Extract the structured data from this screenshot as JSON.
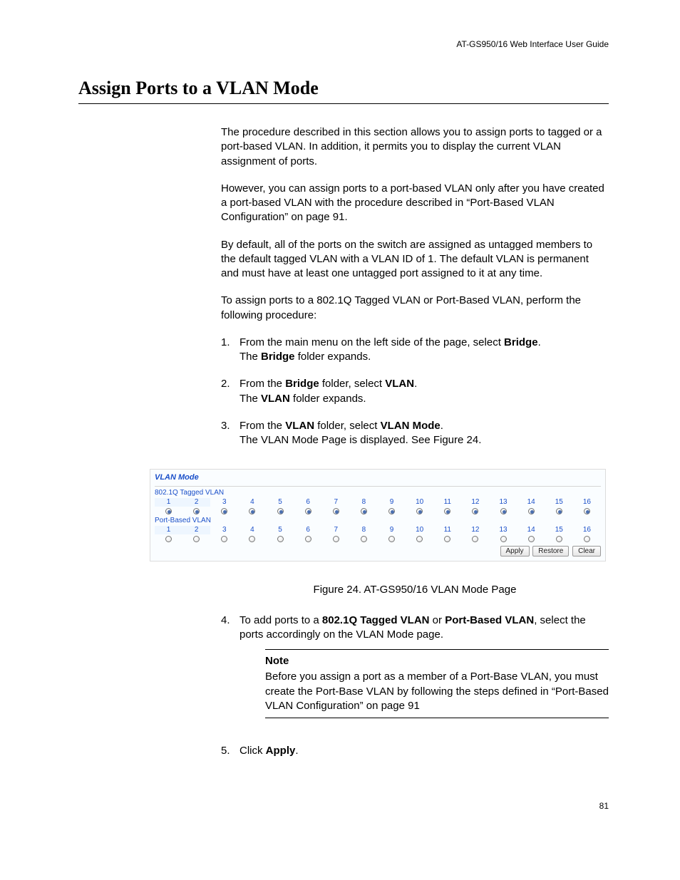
{
  "header": {
    "docTitle": "AT-GS950/16 Web Interface User Guide"
  },
  "title": "Assign Ports to a VLAN Mode",
  "para1": "The procedure described in this section allows you to assign ports to tagged or a port-based VLAN. In addition, it permits you to display the current VLAN assignment of ports.",
  "para2": "However, you can assign ports to a port-based VLAN only after you have created a port-based VLAN with the procedure described in “Port-Based VLAN Configuration” on page 91.",
  "para3": "By default, all of the ports on the switch are assigned as untagged members to the default tagged VLAN with a VLAN ID of 1. The default VLAN is permanent and must have at least one untagged port assigned to it at any time.",
  "para4": "To assign ports to a 802.1Q Tagged VLAN or Port-Based VLAN, perform the following procedure:",
  "steps": {
    "s1num": "1.",
    "s1a": "From the main menu on the left side of the page, select ",
    "s1b": "Bridge",
    "s1c": ".",
    "s1d": "The ",
    "s1e": "Bridge",
    "s1f": " folder expands.",
    "s2num": "2.",
    "s2a": "From the ",
    "s2b": "Bridge",
    "s2c": " folder, select ",
    "s2d": "VLAN",
    "s2e": ".",
    "s2f": "The ",
    "s2g": "VLAN",
    "s2h": " folder expands.",
    "s3num": "3.",
    "s3a": "From the ",
    "s3b": "VLAN",
    "s3c": " folder, select ",
    "s3d": "VLAN Mode",
    "s3e": ".",
    "s3f": "The VLAN Mode Page is displayed. See Figure 24.",
    "s4num": "4.",
    "s4a": "To add ports to a ",
    "s4b": "802.1Q Tagged VLAN",
    "s4c": " or ",
    "s4d": "Port-Based VLAN",
    "s4e": ", select the ports accordingly on the VLAN Mode page.",
    "s5num": "5.",
    "s5a": "Click ",
    "s5b": "Apply",
    "s5c": "."
  },
  "vlan": {
    "title": "VLAN Mode",
    "sub1": "802.1Q Tagged VLAN",
    "sub2": "Port-Based VLAN",
    "ports": [
      "1",
      "2",
      "3",
      "4",
      "5",
      "6",
      "7",
      "8",
      "9",
      "10",
      "11",
      "12",
      "13",
      "14",
      "15",
      "16"
    ],
    "btnApply": "Apply",
    "btnRestore": "Restore",
    "btnClear": "Clear"
  },
  "figCaption": "Figure 24. AT-GS950/16 VLAN Mode Page",
  "note": {
    "label": "Note",
    "text": "Before you assign a port as a member of a Port-Base VLAN, you must create the Port-Base VLAN by following the steps defined in “Port-Based VLAN Configuration” on page 91"
  },
  "pageNum": "81",
  "chart_data": {
    "type": "table",
    "title": "VLAN Mode port assignment",
    "ports": [
      1,
      2,
      3,
      4,
      5,
      6,
      7,
      8,
      9,
      10,
      11,
      12,
      13,
      14,
      15,
      16
    ],
    "rows": [
      {
        "mode": "802.1Q Tagged VLAN",
        "selected": [
          true,
          true,
          true,
          true,
          true,
          true,
          true,
          true,
          true,
          true,
          true,
          true,
          true,
          true,
          true,
          true
        ]
      },
      {
        "mode": "Port-Based VLAN",
        "selected": [
          false,
          false,
          false,
          false,
          false,
          false,
          false,
          false,
          false,
          false,
          false,
          false,
          false,
          false,
          false,
          false
        ]
      }
    ]
  }
}
